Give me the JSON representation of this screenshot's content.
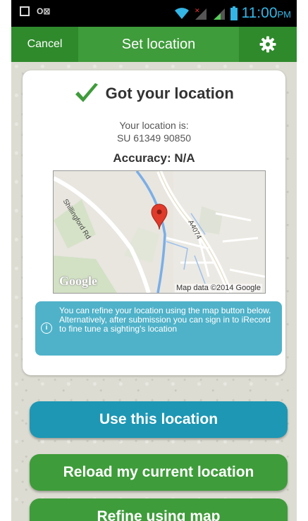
{
  "status_bar": {
    "time": "11:00",
    "ampm": "PM",
    "icons": [
      "picture-icon",
      "outlook-icon",
      "wifi-icon",
      "signal-icon",
      "signal-icon",
      "battery-icon"
    ]
  },
  "action_bar": {
    "cancel_label": "Cancel",
    "title": "Set location",
    "settings_icon": "gear-icon"
  },
  "card": {
    "heading": "Got your location",
    "location_label": "Your location is:",
    "grid_ref": "SU 61349 90850",
    "accuracy": "Accuracy: N/A",
    "map": {
      "road_label_1": "Shillingford Rd",
      "road_label_2": "A4074",
      "google_logo": "Google",
      "attribution": "Map data ©2014 Google"
    },
    "info_text": "You can refine your location using the map button below. Alternatively, after submission you can sign in to iRecord to fine tune a sighting's location"
  },
  "buttons": {
    "use_location": "Use this location",
    "reload_location": "Reload my current location",
    "refine_map": "Refine using map"
  },
  "colors": {
    "green": "#3e9c3a",
    "dark_green": "#2f8a2c",
    "teal": "#1d97b4",
    "info_blue": "#4fb2c9",
    "status_blue": "#33b5e5"
  }
}
